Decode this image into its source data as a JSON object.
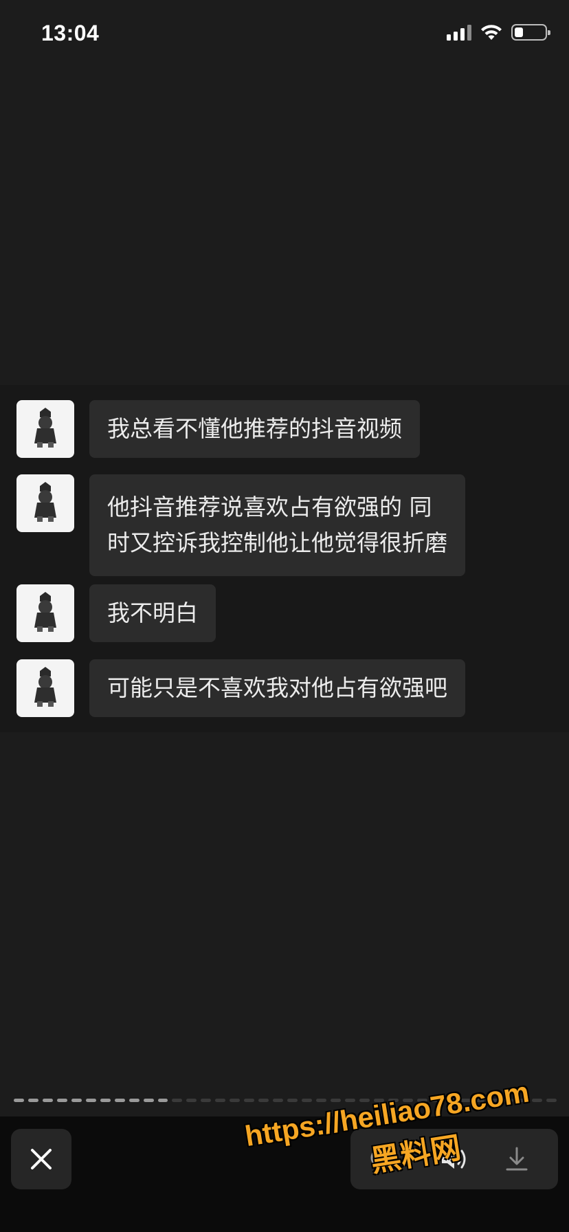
{
  "status_bar": {
    "time": "13:04"
  },
  "chat": {
    "messages": [
      {
        "text": "我总看不懂他推荐的抖音视频"
      },
      {
        "text": "他抖音推荐说喜欢占有欲强的 同\n时又控诉我控制他让他觉得很折磨"
      },
      {
        "text": "我不明白"
      },
      {
        "text": "可能只是不喜欢我对他占有欲强吧"
      }
    ]
  },
  "viewer": {
    "progress": {
      "total_segments": 38,
      "current_segment": 11
    }
  },
  "toolbar": {
    "icons": [
      "close-icon",
      "search-image-icon",
      "speaker-icon",
      "download-icon"
    ]
  },
  "watermark": {
    "url": "https://heiliao78.com",
    "name": "黑料网"
  },
  "colors": {
    "background": "#1c1c1c",
    "bubble": "#2c2c2c",
    "watermark": "#f6a623"
  }
}
